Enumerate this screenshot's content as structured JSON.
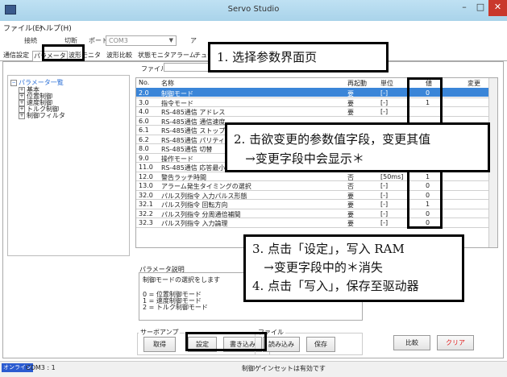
{
  "window": {
    "title": "Servo Studio",
    "app_icon": "app-icon",
    "min": "–",
    "max": "□",
    "close": "✕"
  },
  "menu": [
    "ファイル(E)",
    "ヘルプ(H)"
  ],
  "toolbar": {
    "connect": "接続",
    "disconnect": "切断",
    "port_label": "ポート",
    "port_value": "COM3",
    "a": "ア"
  },
  "tabs": [
    "通信設定",
    "パラメータ",
    "波形モニタ",
    "波形比較",
    "状態モニタ",
    "アラーム",
    "チュー"
  ],
  "file_label": "ファイル名",
  "tree": {
    "root": "パラメータ一覧",
    "items": [
      "基本",
      "位置制御",
      "速度制御",
      "トルク制御",
      "制御フィルタ"
    ]
  },
  "table": {
    "headers": [
      "No.",
      "名称",
      "再起動",
      "単位",
      "値",
      "変更"
    ],
    "rows": [
      [
        "2.0",
        "制御モード",
        "要",
        "[-]",
        "0",
        ""
      ],
      [
        "3.0",
        "指令モード",
        "要",
        "[-]",
        "1",
        ""
      ],
      [
        "4.0",
        "RS-485通信 アドレス",
        "要",
        "[-]",
        "",
        ""
      ],
      [
        "6.0",
        "RS-485通信 通信速度",
        "",
        "",
        "",
        ""
      ],
      [
        "6.1",
        "RS-485通信 ストップビット",
        "",
        "",
        "",
        ""
      ],
      [
        "6.2",
        "RS-485通信 パリティ",
        "",
        "",
        "",
        ""
      ],
      [
        "8.0",
        "RS-485通信 切替",
        "",
        "",
        "",
        ""
      ],
      [
        "9.0",
        "操作モード",
        "",
        "",
        "",
        ""
      ],
      [
        "11.0",
        "RS-485通信 応答最小時",
        "",
        "",
        "",
        ""
      ],
      [
        "12.0",
        "警告ラッチ時間",
        "否",
        "[50ms]",
        "1",
        ""
      ],
      [
        "13.0",
        "アラーム発生タイミングの選択",
        "否",
        "[-]",
        "0",
        ""
      ],
      [
        "32.0",
        "パルス列指令 入力パルス形態",
        "要",
        "[-]",
        "0",
        ""
      ],
      [
        "32.1",
        "パルス列指令 回転方向",
        "要",
        "[-]",
        "1",
        ""
      ],
      [
        "32.2",
        "パルス列指令 分周通倍補間",
        "要",
        "[-]",
        "0",
        ""
      ],
      [
        "32.3",
        "パルス列指令 入力論理",
        "要",
        "[-]",
        "0",
        ""
      ]
    ]
  },
  "description": {
    "label": "パラメータ説明",
    "lines": [
      "制御モードの選択をします",
      "",
      "0 = 位置制御モード",
      "1 = 速度制御モード",
      "2 = トルク制御モード"
    ]
  },
  "servo_amp": {
    "label": "サーボアンプ",
    "read": "取得",
    "set": "設定",
    "write": "書き込み"
  },
  "file_group": {
    "label": "ファイル",
    "load": "読み込み",
    "save": "保存"
  },
  "compare": "比較",
  "clear": "クリア",
  "status": {
    "online": "オンライン",
    "com": "COM3 : 1",
    "gain": "制御ゲインセットは有効です"
  },
  "annotations": {
    "step1": "1. 选择参数界面页",
    "step2_l1": "2. 击欲变更的参数值字段，变更其值",
    "step2_l2": "   →变更字段中会显示＊",
    "step3_l1": "3. 点击「设定」，写入 RAM",
    "step3_l2": "   →变更字段中的＊消失",
    "step3_l3": "4. 点击「写入」，保存至驱动器"
  },
  "colors": {
    "selection": "#3a85d8",
    "clear_text": "#e02020",
    "online_badge": "#2b5bd0",
    "close": "#c9382c"
  }
}
